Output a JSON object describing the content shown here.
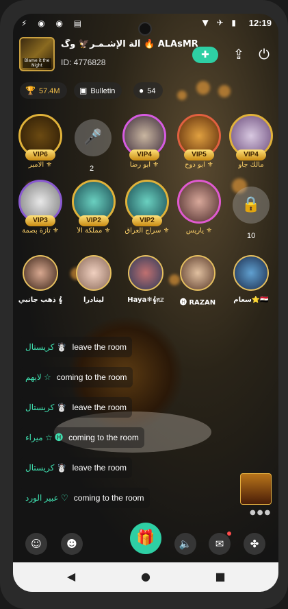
{
  "status_bar": {
    "time": "12:19",
    "left_icons": "⚡ ◉ ◉ ▤",
    "right_icons": "▼ ✈ ▮"
  },
  "header": {
    "room_name": "آلة الإشـمـر🦅 وگ 🔥 ALAsMR",
    "room_id": "ID: 4776828",
    "avatar_caption": "Blame it the Night"
  },
  "info_pills": {
    "trophy": {
      "icon": "trophy-icon",
      "label": "57.4M"
    },
    "bulletin": {
      "icon": "briefcase-icon",
      "label": "Bulletin"
    },
    "members": {
      "icon": "person-icon",
      "label": "54"
    }
  },
  "seats_row1": [
    {
      "vip": "VIP6",
      "name": "الامبر ⚜"
    },
    {
      "empty": "mic",
      "number": "2"
    },
    {
      "vip": "VIP4",
      "name": "ابو رضا ⚜"
    },
    {
      "vip": "VIP5",
      "name": "ابو دوح ⚜"
    },
    {
      "vip": "VIP4",
      "name": "مالك جاو"
    }
  ],
  "seats_row2": [
    {
      "vip": "VIP3",
      "name": "تازة بصمة ⚜"
    },
    {
      "vip": "VIP2",
      "name": "مملكة الأ ⚜"
    },
    {
      "vip": "VIP2",
      "name": "سراج العراق ⚜"
    },
    {
      "vip": "",
      "name": "ياريس ⚜"
    },
    {
      "empty": "lock",
      "number": "10"
    }
  ],
  "audience": [
    {
      "name": "ذهب جانبي 𝄞"
    },
    {
      "name": "لينادرا"
    },
    {
      "name": "Haya❄𝄞𝔫𝕫"
    },
    {
      "name": "🅗 RAZAN"
    },
    {
      "name": "سعام⭐🇪🇬"
    }
  ],
  "messages": [
    {
      "name": "كريستال ☃️",
      "text": "leave the room"
    },
    {
      "name": "لايهم ☆",
      "text": "coming to the room"
    },
    {
      "name": "كريستال ☃️",
      "text": "leave the room"
    },
    {
      "name": "ميراء ☆ 🅗",
      "text": "coming to the room"
    },
    {
      "name": "كريستال ☃️",
      "text": "leave the room"
    },
    {
      "name": "عبير الورد ♡",
      "text": "coming to the room"
    }
  ],
  "colors": {
    "accent": "#2ecfa4",
    "name_teal": "#3fe0b0",
    "gold": "#ffd36a"
  },
  "bottom_bar": {
    "emoji_icon": "smile-icon",
    "emoji2_icon": "face-icon",
    "gift_icon": "gift-icon",
    "speaker_icon": "speaker-icon",
    "mail_icon": "mail-icon",
    "grid_icon": "grid-icon"
  }
}
